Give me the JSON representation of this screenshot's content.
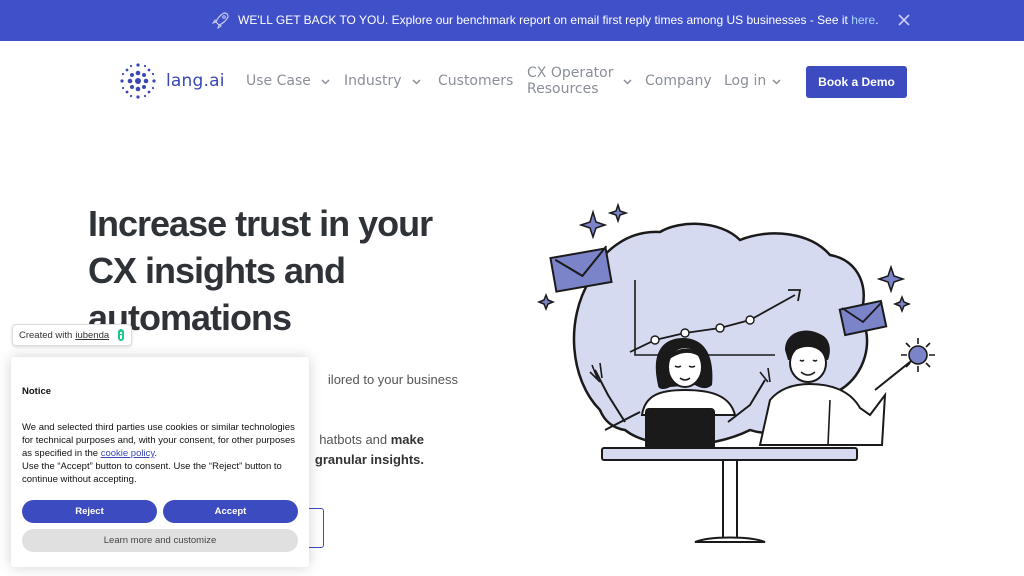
{
  "banner": {
    "prefix": "WE'LL GET BACK TO YOU. Explore our benchmark report on email first reply times among US businesses - See it ",
    "link": "here",
    "suffix": ".",
    "rocket_icon": "rocket-icon",
    "close_icon": "close-icon"
  },
  "nav": {
    "logo_text": "lang.ai",
    "items": [
      {
        "label": "Use Case",
        "has_chevron": true
      },
      {
        "label": "Industry",
        "has_chevron": true
      },
      {
        "label": "Customers",
        "has_chevron": false
      },
      {
        "label_line1": "CX Operator",
        "label_line2": "Resources",
        "has_chevron": true
      },
      {
        "label": "Company",
        "has_chevron": false
      },
      {
        "label": "Log in",
        "has_chevron": true
      }
    ],
    "cta": "Book a Demo"
  },
  "hero": {
    "title_line1": "Increase trust in your",
    "title_line2": "CX insights and",
    "title_line3": "automations",
    "p1": "ilored to your business",
    "p2_a": "hatbots and ",
    "p2_b": "make",
    "p2_c": "granular insights."
  },
  "iubenda": {
    "prefix": "Created with",
    "link": "iubenda"
  },
  "cookie": {
    "title": "Notice",
    "body_a": "We and selected third parties use cookies or similar technologies for technical purposes and, with your consent, for other purposes as specified in the ",
    "policy_link": "cookie policy",
    "body_b": ".",
    "body_c": "Use the “Accept” button to consent. Use the “Reject” button to continue without accepting.",
    "reject": "Reject",
    "accept": "Accept",
    "learn": "Learn more and customize"
  },
  "colors": {
    "brand": "#3d4bc1",
    "banner_bg": "#4050c8",
    "link_light": "#a9d4ff",
    "cloud": "#d6daf0"
  }
}
